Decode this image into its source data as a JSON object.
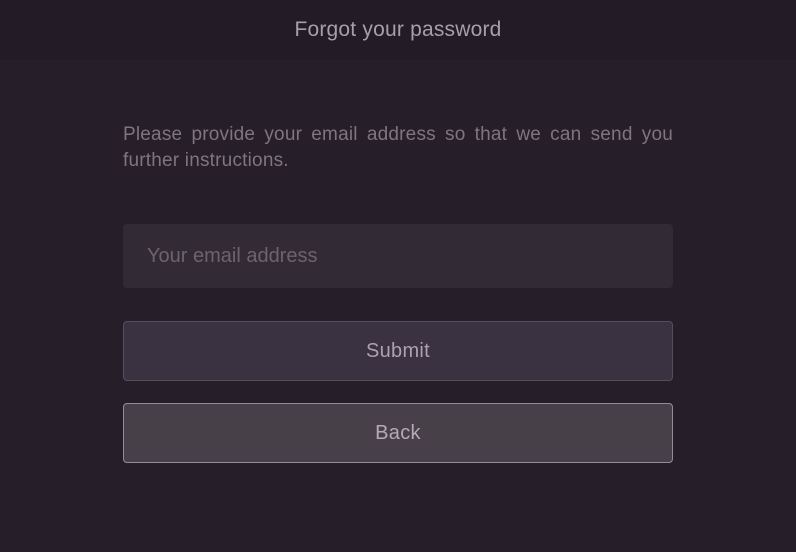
{
  "header": {
    "title": "Forgot your password"
  },
  "form": {
    "instruction": "Please provide your email address so that we can send you further instructions.",
    "email_placeholder": "Your email address",
    "email_value": "",
    "submit_label": "Submit",
    "back_label": "Back"
  }
}
